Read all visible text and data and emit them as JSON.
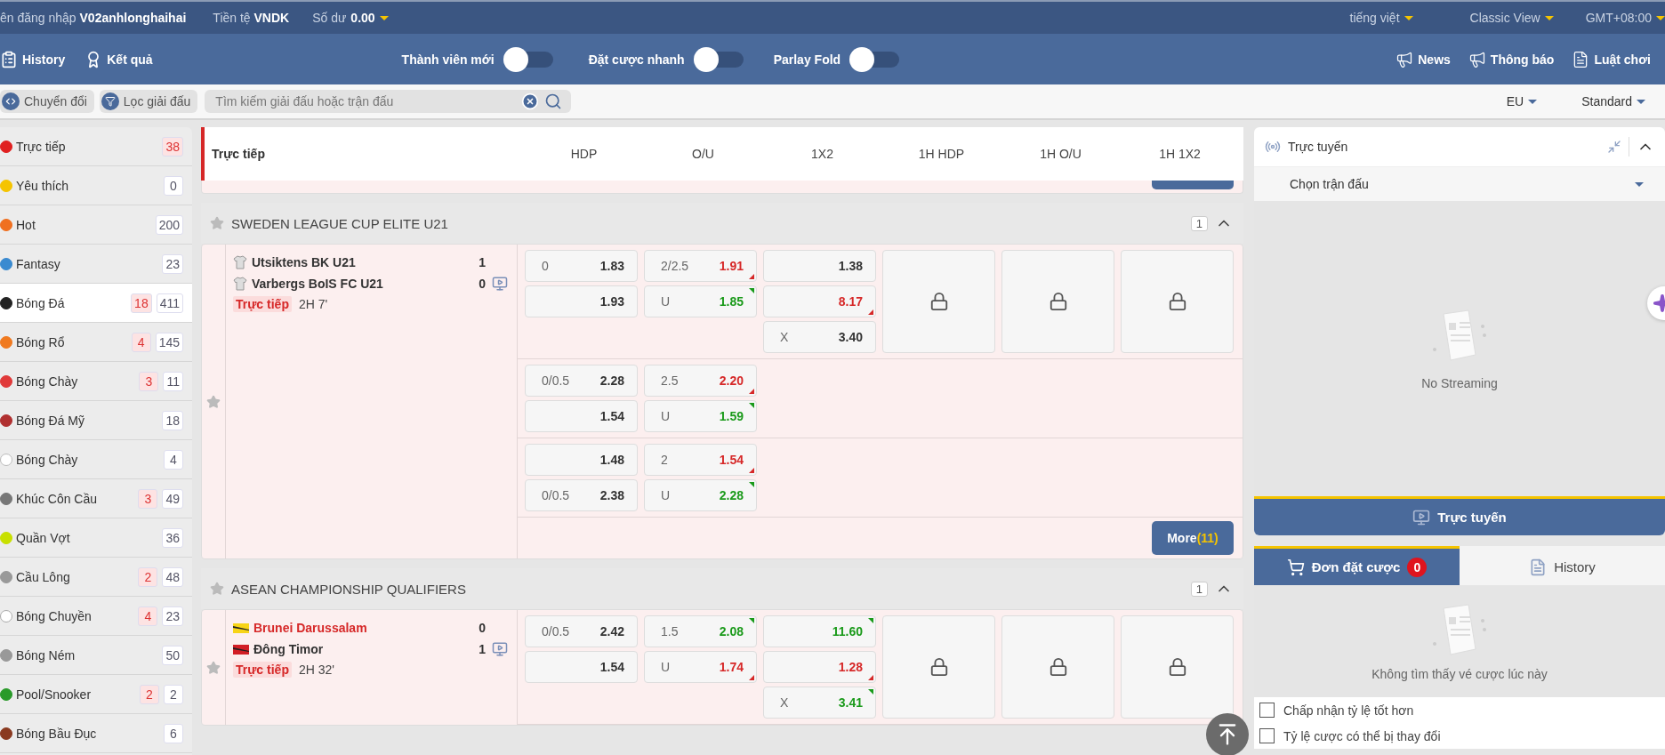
{
  "top_bar": {
    "login_label": "ên đăng nhập",
    "username": "V02anhlonghaihai",
    "currency_label": "Tiền tệ",
    "currency": "VNDK",
    "balance_label": "Số dư",
    "balance": "0.00",
    "language": "tiếng việt",
    "view": "Classic View",
    "timezone": "GMT+08:00"
  },
  "nav_bar": {
    "links": [
      {
        "label": "History"
      },
      {
        "label": "Kết quả"
      }
    ],
    "toggles": [
      {
        "label": "Thành viên mới",
        "on": false
      },
      {
        "label": "Đặt cược nhanh",
        "on": false
      },
      {
        "label": "Parlay Fold",
        "on": false
      }
    ],
    "right_links": [
      {
        "label": "News"
      },
      {
        "label": "Thông báo"
      },
      {
        "label": "Luật chơi"
      }
    ]
  },
  "filter_bar": {
    "buttons": [
      "Chuyển đổi",
      "Lọc giải đấu"
    ],
    "search": {
      "placeholder": "Tìm kiếm giải đấu hoặc trận đấu"
    },
    "odds_type": "EU",
    "display": "Standard"
  },
  "sidebar": {
    "items": [
      {
        "label": "Trực tiếp",
        "live_count": "38",
        "selected": false
      },
      {
        "label": "Yêu thích",
        "count": "0",
        "selected": false
      },
      {
        "label": "Hot",
        "count": "200",
        "selected": false
      },
      {
        "label": "Fantasy",
        "count": "23",
        "selected": false
      },
      {
        "label": "Bóng Đá",
        "live_count": "18",
        "count": "411",
        "selected": true
      },
      {
        "label": "Bóng Rổ",
        "live_count": "4",
        "count": "145",
        "selected": false
      },
      {
        "label": "Bóng Chày",
        "live_count": "3",
        "count": "11",
        "selected": false
      },
      {
        "label": "Bóng Đá Mỹ",
        "count": "18",
        "selected": false
      },
      {
        "label": "Bóng Chày",
        "count": "4",
        "selected": false
      },
      {
        "label": "Khúc Côn Cầu",
        "live_count": "3",
        "count": "49",
        "selected": false
      },
      {
        "label": "Quần Vợt",
        "count": "36",
        "selected": false
      },
      {
        "label": "Cầu Lông",
        "live_count": "2",
        "count": "48",
        "selected": false
      },
      {
        "label": "Bóng Chuyền",
        "live_count": "4",
        "count": "23",
        "selected": false
      },
      {
        "label": "Bóng Ném",
        "count": "50",
        "selected": false
      },
      {
        "label": "Pool/Snooker",
        "live_count": "2",
        "count": "2",
        "selected": false
      },
      {
        "label": "Bóng Bầu Đục",
        "count": "6",
        "selected": false
      }
    ]
  },
  "market": {
    "title": "Trực tiếp",
    "columns": [
      "HDP",
      "O/U",
      "1X2",
      "1H HDP",
      "1H O/U",
      "1H 1X2"
    ],
    "leagues": [
      {
        "name": "SWEDEN LEAGUE CUP ELITE U21",
        "count": "1",
        "expanded": true,
        "match": {
          "teams": [
            {
              "name": "Utsiktens BK U21",
              "score": "1",
              "kind": "shirt",
              "favored": false
            },
            {
              "name": "Varbergs BoIS FC U21",
              "score": "0",
              "kind": "shirt",
              "favored": false
            }
          ],
          "status": "Trực tiếp",
          "time": "2H 7'",
          "favorite": false,
          "video": true,
          "lines": [
            {
              "hdp": [
                {
                  "handicap": "0",
                  "odds": "1.83",
                  "rose": false,
                  "fell": false
                },
                {
                  "odds": "1.93",
                  "rose": false,
                  "fell": false
                }
              ],
              "ou": [
                {
                  "handicap": "2/2.5",
                  "odds": "1.91",
                  "rose": false,
                  "fell": true
                },
                {
                  "handicap": "U",
                  "odds": "1.85",
                  "rose": true,
                  "fell": false
                }
              ],
              "x12": [
                {
                  "odds": "1.38",
                  "rose": false,
                  "fell": false
                },
                {
                  "odds": "8.17",
                  "rose": false,
                  "fell": true
                },
                {
                  "handicap": "X",
                  "odds": "3.40",
                  "rose": false,
                  "fell": false
                }
              ],
              "first_half_locked": true
            },
            {
              "hdp": [
                {
                  "handicap": "0/0.5",
                  "odds": "2.28",
                  "rose": false,
                  "fell": false
                },
                {
                  "odds": "1.54",
                  "rose": false,
                  "fell": false
                }
              ],
              "ou": [
                {
                  "handicap": "2.5",
                  "odds": "2.20",
                  "rose": false,
                  "fell": true
                },
                {
                  "handicap": "U",
                  "odds": "1.59",
                  "rose": true,
                  "fell": false
                }
              ]
            },
            {
              "hdp": [
                {
                  "odds": "1.48",
                  "rose": false,
                  "fell": false
                },
                {
                  "handicap": "0/0.5",
                  "odds": "2.38",
                  "rose": false,
                  "fell": false
                }
              ],
              "ou": [
                {
                  "handicap": "2",
                  "odds": "1.54",
                  "rose": false,
                  "fell": true
                },
                {
                  "handicap": "U",
                  "odds": "2.28",
                  "rose": true,
                  "fell": false
                }
              ]
            }
          ],
          "more": {
            "label": "More",
            "count": "(11)"
          }
        }
      },
      {
        "name": "ASEAN CHAMPIONSHIP QUALIFIERS",
        "count": "1",
        "expanded": true,
        "match": {
          "teams": [
            {
              "name": "Brunei Darussalam",
              "score": "0",
              "kind": "flag",
              "color": "#f7d417",
              "favored": true
            },
            {
              "name": "Đông Timor",
              "score": "1",
              "kind": "flag",
              "color": "#d21f26",
              "favored": false
            }
          ],
          "status": "Trực tiếp",
          "time": "2H 32'",
          "favorite": false,
          "video": true,
          "lines": [
            {
              "hdp": [
                {
                  "handicap": "0/0.5",
                  "odds": "2.42",
                  "rose": false,
                  "fell": false
                },
                {
                  "odds": "1.54",
                  "rose": false,
                  "fell": false
                }
              ],
              "ou": [
                {
                  "handicap": "1.5",
                  "odds": "2.08",
                  "rose": true,
                  "fell": false
                },
                {
                  "handicap": "U",
                  "odds": "1.74",
                  "rose": false,
                  "fell": true
                }
              ],
              "x12": [
                {
                  "odds": "11.60",
                  "rose": true,
                  "fell": false
                },
                {
                  "odds": "1.28",
                  "rose": false,
                  "fell": true
                },
                {
                  "handicap": "X",
                  "odds": "3.41",
                  "rose": true,
                  "fell": false
                }
              ],
              "first_half_locked": true
            }
          ]
        }
      }
    ]
  },
  "streaming": {
    "title": "Trực tuyến",
    "select": "Chọn trận đấu",
    "empty": "No Streaming",
    "button": "Trực tuyến"
  },
  "bet_slip": {
    "tabs": [
      {
        "label": "Đơn đặt cược",
        "badge": "0",
        "selected": true
      },
      {
        "label": "History",
        "selected": false
      }
    ],
    "empty": "Không tìm thấy vé cược lúc này",
    "options": [
      {
        "label": "Chấp nhận tỷ lệ tốt hơn",
        "checked": false
      },
      {
        "label": "Tỷ lệ cược có thể bị thay đổi",
        "checked": false
      }
    ]
  }
}
